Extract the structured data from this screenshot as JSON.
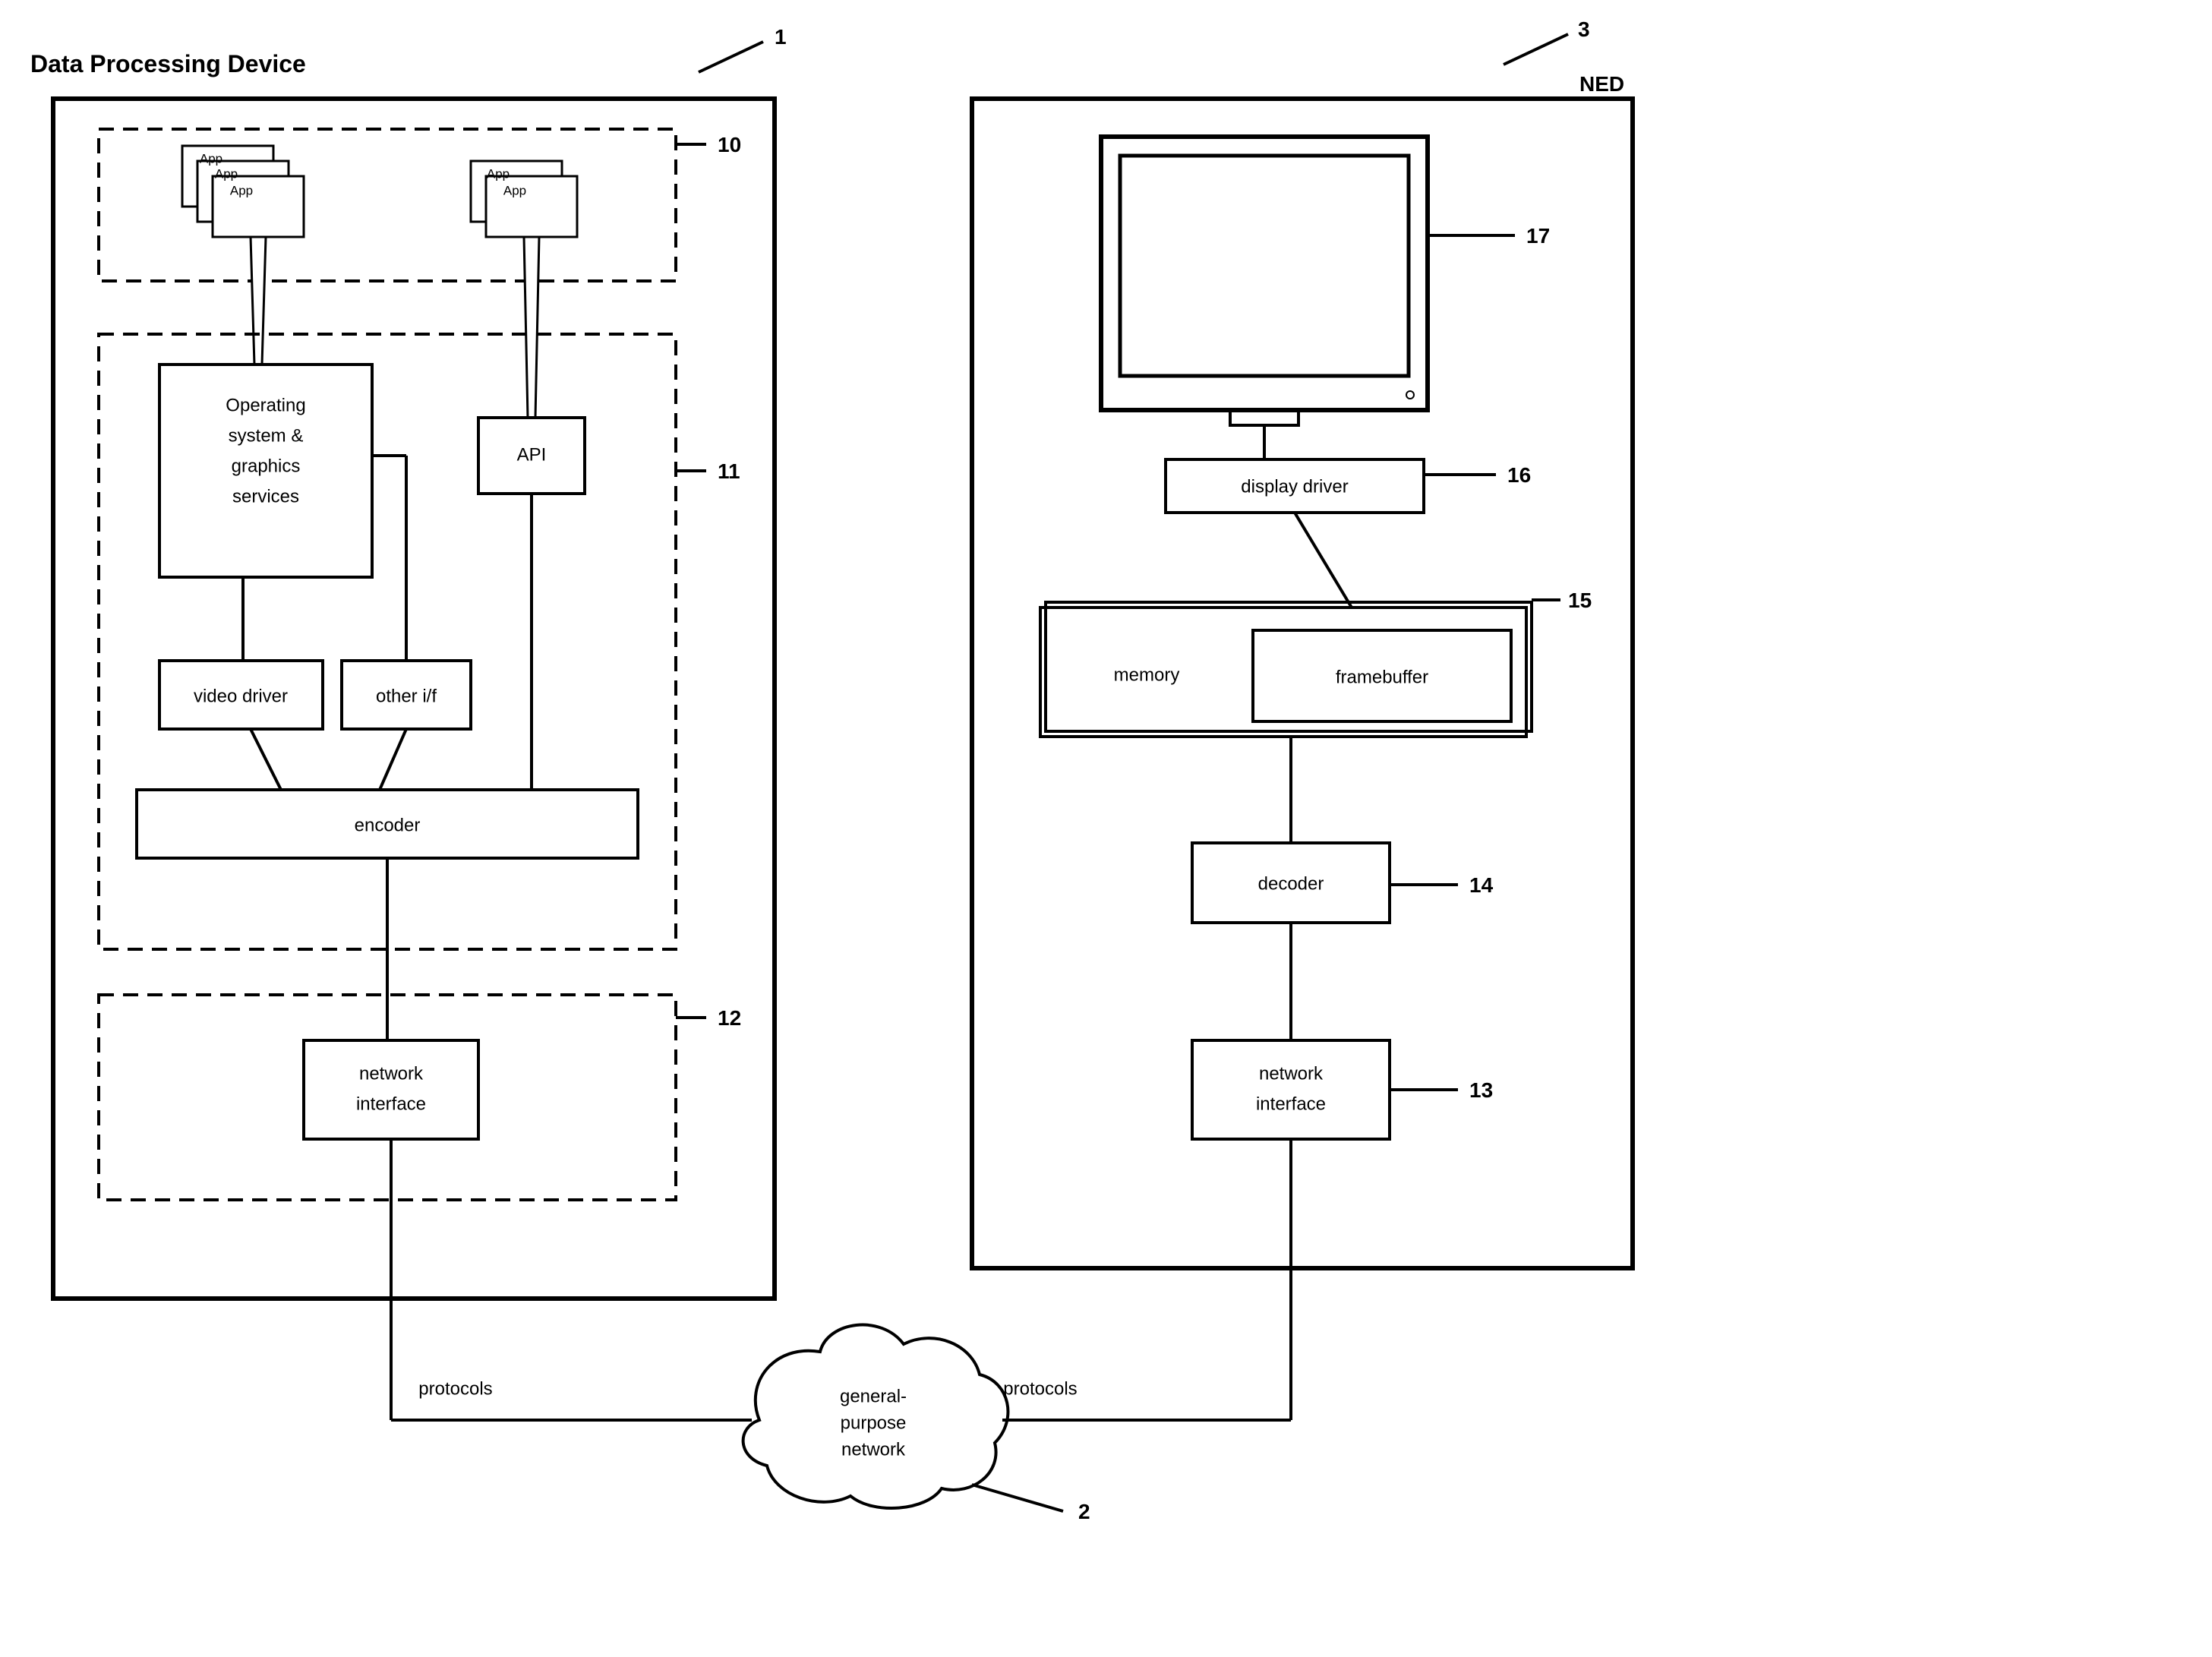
{
  "title": "Data Processing Device",
  "ned_label": "NED",
  "left_device": {
    "apps": "App",
    "os_box": {
      "line1": "Operating",
      "line2": "system &",
      "line3": "graphics",
      "line4": "services"
    },
    "api": "API",
    "video_driver": "video driver",
    "other_if": "other i/f",
    "encoder": "encoder",
    "network_interface": {
      "line1": "network",
      "line2": "interface"
    }
  },
  "right_device": {
    "display_driver": "display driver",
    "memory": "memory",
    "framebuffer": "framebuffer",
    "decoder": "decoder",
    "network_interface": {
      "line1": "network",
      "line2": "interface"
    }
  },
  "network": {
    "line1": "general-",
    "line2": "purpose",
    "line3": "network"
  },
  "protocols": "protocols",
  "refs": {
    "r1": "1",
    "r2": "2",
    "r3": "3",
    "r10": "10",
    "r11": "11",
    "r12": "12",
    "r13": "13",
    "r14": "14",
    "r15": "15",
    "r16": "16",
    "r17": "17"
  }
}
